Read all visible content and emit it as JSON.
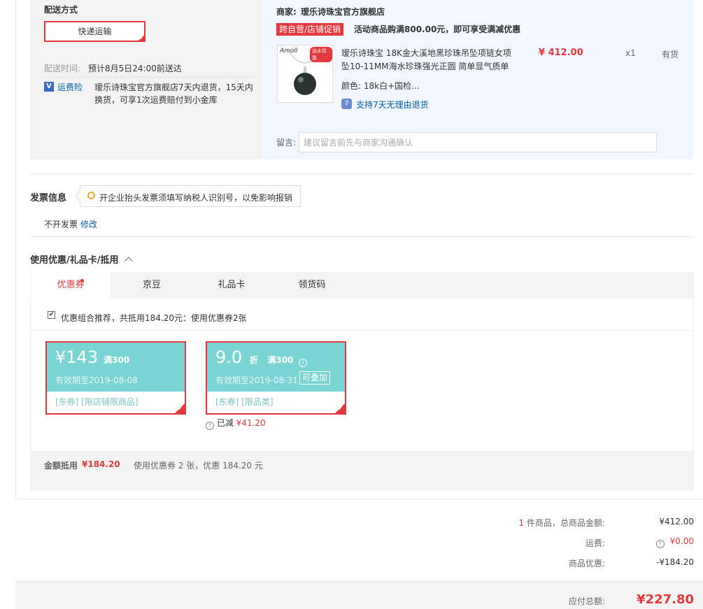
{
  "delivery": {
    "section_title": "配送方式",
    "method_label": "快递运输",
    "time_label": "配送时间:",
    "time_value": "预计8月5日24:00前送达",
    "insurance_icon_text": "V",
    "insurance_link": "运费险",
    "insurance_desc_line1": "瑷乐诗珠宝官方旗舰店7天内退货，15天内",
    "insurance_desc_line2": "换货，可享1次运费赔付到小金库"
  },
  "shop": {
    "merchant_label": "商家:",
    "merchant_name": "瑷乐诗珠宝官方旗舰店",
    "promo_tag": "跨自营/店铺促销",
    "promo_text": "活动商品购满800.00元，即可享受满减优惠",
    "item": {
      "thumb_brand_text": "Amoll",
      "thumb_badge_text": "淡水珍珠",
      "title_line1": "瑷乐诗珠宝 18K金大溪地黑珍珠吊坠项链女项",
      "title_line2": "坠10-11MM海水珍珠强光正圆 简单显气质单",
      "color_label": "颜色:",
      "color_value": "18k白+国检...",
      "return_icon": "7",
      "return_text": "支持7天无理由退货",
      "price": "¥ 412.00",
      "qty": "x1",
      "stock": "有货"
    },
    "note_label": "留言:",
    "note_placeholder": "建议留言前先与商家沟通确认"
  },
  "invoice": {
    "title": "发票信息",
    "tip": "开企业抬头发票须填写纳税人识别号，以免影响报销",
    "status": "不开发票",
    "modify": "修改"
  },
  "discount": {
    "title": "使用优惠/礼品卡/抵用",
    "tabs": [
      "优惠券",
      "京豆",
      "礼品卡",
      "领货码"
    ],
    "combo_check": "✔",
    "combo_text": "优惠组合推荐，共抵用184.20元：使用优惠券2张",
    "coupons": [
      {
        "currency": "¥",
        "amount": "143",
        "condition": "满300",
        "expiry": "有效期至2019-08-08",
        "tags": "[东券]  [限店铺限商品]"
      },
      {
        "amount": "9.0",
        "unit": "折",
        "condition": "满300",
        "expiry": "有效期至2019-08-31",
        "badge": "可叠加",
        "tags": "[东券]  [限品类]",
        "reduced_label": "已减",
        "reduced_value": "¥41.20"
      }
    ],
    "summary_label": "金额抵用",
    "summary_value": "¥184.20",
    "summary_desc": "使用优惠券 2 张，优惠 184.20 元"
  },
  "totals": {
    "count": "1",
    "count_suffix": "件商品，总商品金额:",
    "goods_amount": "¥412.00",
    "shipping_label": "运费:",
    "shipping_value": "¥0.00",
    "discount_label": "商品优惠:",
    "discount_value": "-¥184.20",
    "payable_label": "应付总额:",
    "payable_value": "¥227.80"
  },
  "colors": {
    "accent": "#e4393c",
    "coupon": "#79d4d3",
    "link": "#005ea7"
  }
}
